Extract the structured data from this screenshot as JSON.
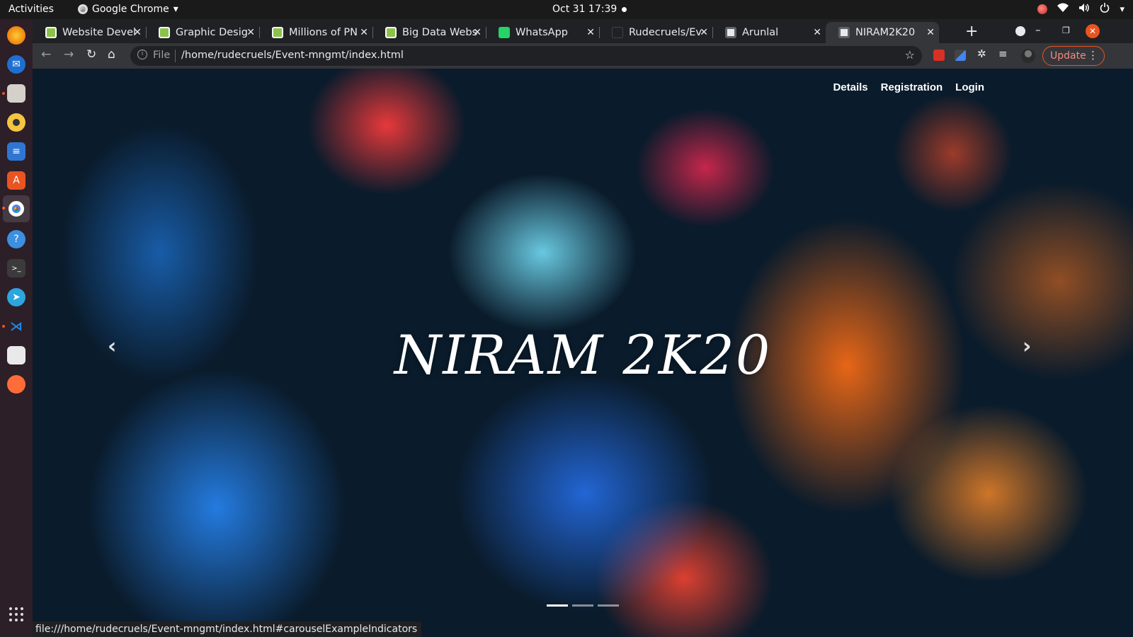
{
  "topbar": {
    "activities": "Activities",
    "app_name": "Google Chrome",
    "app_menu_arrow": "▾",
    "clock": "Oct 31  17:39"
  },
  "dock": {
    "icons": [
      "firefox-icon",
      "thunderbird-icon",
      "files-icon",
      "rhythmbox-icon",
      "writer-icon",
      "software-icon",
      "chrome-icon",
      "help-icon",
      "terminal-icon",
      "telegram-icon",
      "vscode-icon",
      "document-viewer-icon",
      "postman-icon"
    ]
  },
  "tabs": [
    {
      "label": "Website Devel",
      "favicon": "green"
    },
    {
      "label": "Graphic Desig",
      "favicon": "green"
    },
    {
      "label": "Millions of PN",
      "favicon": "green"
    },
    {
      "label": "Big Data Webs",
      "favicon": "green"
    },
    {
      "label": "WhatsApp",
      "favicon": "whatsapp"
    },
    {
      "label": "Rudecruels/Ev",
      "favicon": "github"
    },
    {
      "label": "Arunlal",
      "favicon": "globe"
    },
    {
      "label": "NIRAM2K20",
      "favicon": "globe",
      "active": true
    }
  ],
  "toolbar": {
    "scheme": "File",
    "url": "/home/rudecruels/Event-mngmt/index.html",
    "update_label": "Update"
  },
  "page": {
    "nav": [
      "Details",
      "Registration",
      "Login"
    ],
    "title": "NIRAM 2K20",
    "carousel_slides": 3,
    "carousel_active": 0
  },
  "status_url": "file:///home/rudecruels/Event-mngmt/index.html#carouselExampleIndicators",
  "colors": {
    "ubuntu_orange": "#e95420",
    "tab_bg": "#202124",
    "toolbar_bg": "#35363a"
  }
}
